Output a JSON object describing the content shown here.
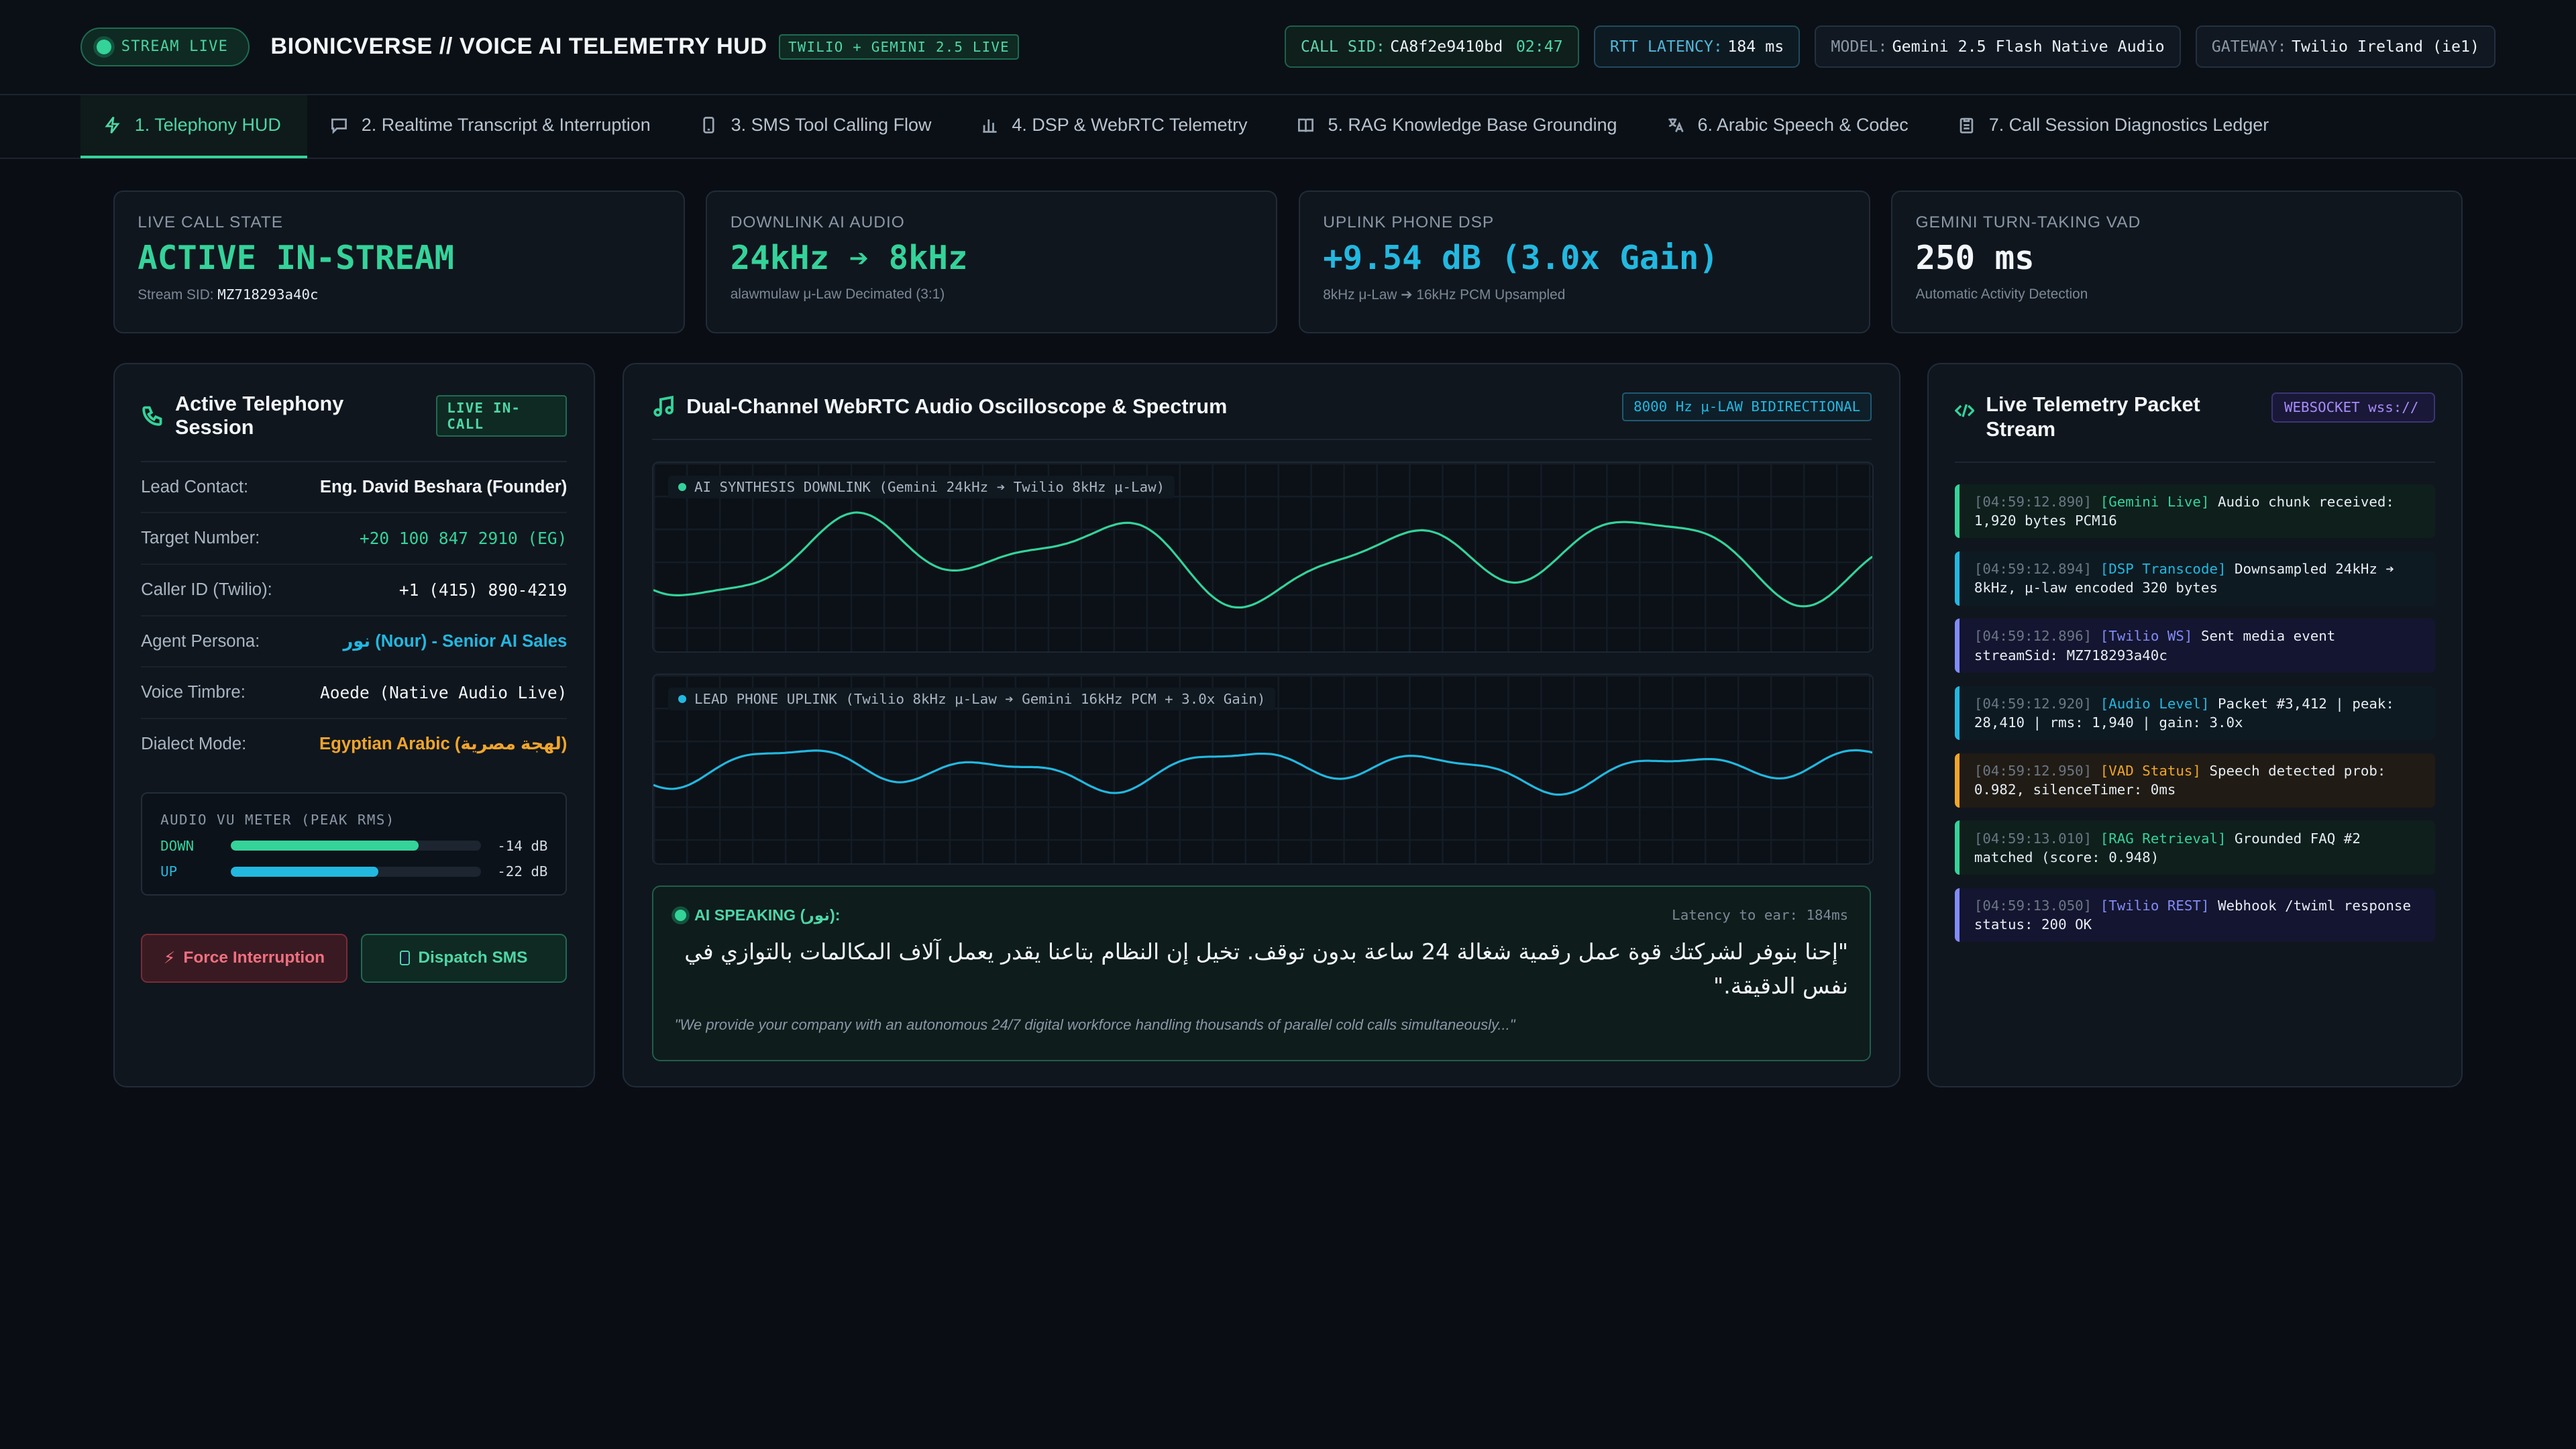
{
  "header": {
    "live_label": "STREAM LIVE",
    "title": "BIONICVERSE // VOICE AI TELEMETRY HUD",
    "tag": "TWILIO + GEMINI 2.5 LIVE",
    "call_sid_key": "CALL SID:",
    "call_sid": "CA8f2e9410bd",
    "call_time": "02:47",
    "rtt_key": "RTT LATENCY:",
    "rtt": "184 ms",
    "model_key": "MODEL:",
    "model": "Gemini 2.5 Flash Native Audio",
    "gateway_key": "GATEWAY:",
    "gateway": "Twilio Ireland (ie1)"
  },
  "tabs": [
    {
      "label": "1. Telephony HUD",
      "icon": "bolt-icon"
    },
    {
      "label": "2. Realtime Transcript & Interruption",
      "icon": "message-icon"
    },
    {
      "label": "3. SMS Tool Calling Flow",
      "icon": "phone-device-icon"
    },
    {
      "label": "4. DSP & WebRTC Telemetry",
      "icon": "bar-chart-icon"
    },
    {
      "label": "5. RAG Knowledge Base Grounding",
      "icon": "book-icon"
    },
    {
      "label": "6. Arabic Speech & Codec",
      "icon": "translate-icon"
    },
    {
      "label": "7. Call Session Diagnostics Ledger",
      "icon": "clipboard-icon"
    }
  ],
  "stats": [
    {
      "label": "LIVE CALL STATE",
      "value": "ACTIVE IN-STREAM",
      "sub_prefix": "Stream SID: ",
      "sub_value": "MZ718293a40c",
      "color": "#34d399"
    },
    {
      "label": "DOWNLINK AI AUDIO",
      "value": "24kHz ➔ 8kHz",
      "sub": "alawmulaw μ-Law Decimated (3:1)",
      "color": "#34d399"
    },
    {
      "label": "UPLINK PHONE DSP",
      "value": "+9.54 dB (3.0x Gain)",
      "sub": "8kHz μ-Law ➔ 16kHz PCM Upsampled",
      "color": "#22b8e0"
    },
    {
      "label": "GEMINI TURN-TAKING VAD",
      "value": "250 ms",
      "sub": "Automatic Activity Detection",
      "color": "#f2f6fa"
    }
  ],
  "session": {
    "title": "Active Telephony Session",
    "badge": "LIVE IN-CALL",
    "rows": [
      {
        "key": "Lead Contact:",
        "value": "Eng. David Beshara (Founder)"
      },
      {
        "key": "Target Number:",
        "value": "+20 100 847 2910 (EG)"
      },
      {
        "key": "Caller ID (Twilio):",
        "value": "+1 (415) 890-4219"
      },
      {
        "key": "Agent Persona:",
        "value": "نور (Nour) - Senior AI Sales"
      },
      {
        "key": "Voice Timbre:",
        "value": "Aoede (Native Audio Live)"
      },
      {
        "key": "Dialect Mode:",
        "value": "Egyptian Arabic (لهجة مصرية)"
      }
    ],
    "vu": {
      "title": "AUDIO VU METER (PEAK RMS)",
      "down_label": "DOWN",
      "down_db": "-14 dB",
      "down_level": 0.75,
      "up_label": "UP",
      "up_db": "-22 dB",
      "up_level": 0.59
    },
    "btn_interrupt": "Force Interruption",
    "btn_sms": "Dispatch SMS"
  },
  "scope": {
    "title": "Dual-Channel WebRTC Audio Oscilloscope & Spectrum",
    "badge": "8000 Hz μ-LAW BIDIRECTIONAL",
    "downlink_label": "AI SYNTHESIS DOWNLINK (Gemini 24kHz ➔ Twilio 8kHz μ-Law)",
    "uplink_label": "LEAD PHONE UPLINK (Twilio 8kHz μ-Law ➔ Gemini 16kHz PCM + 3.0x Gain)",
    "downlink_color": "#34d399",
    "uplink_color": "#22b8e0",
    "speaking_label": "AI SPEAKING (نور):",
    "latency": "Latency to ear: 184ms",
    "arabic_text": "\"إحنا بنوفر لشركتك قوة عمل رقمية شغالة 24 ساعة بدون توقف. تخيل إن النظام بتاعنا يقدر يعمل آلاف المكالمات بالتوازي في نفس الدقيقة.\"",
    "english_text": "\"We provide your company with an autonomous 24/7 digital workforce handling thousands of parallel cold calls simultaneously...\""
  },
  "stream": {
    "title": "Live Telemetry Packet Stream",
    "badge": "WEBSOCKET wss://",
    "packets": [
      {
        "ts": "[04:59:12.890]",
        "src": "[Gemini Live]",
        "msg": "Audio chunk received: 1,920 bytes PCM16",
        "color": "#34d399",
        "bg": "#0e1f1c"
      },
      {
        "ts": "[04:59:12.894]",
        "src": "[DSP Transcode]",
        "msg": "Downsampled 24kHz ➔ 8kHz, μ-law encoded 320 bytes",
        "color": "#22b8e0",
        "bg": "#0e1a22"
      },
      {
        "ts": "[04:59:12.896]",
        "src": "[Twilio WS]",
        "msg": "Sent media event streamSid: MZ718293a40c",
        "color": "#818cf8",
        "bg": "#141530"
      },
      {
        "ts": "[04:59:12.920]",
        "src": "[Audio Level]",
        "msg": "Packet #3,412 | peak: 28,410 | rms: 1,940 | gain: 3.0x",
        "color": "#22b8e0",
        "bg": "#0e1a22"
      },
      {
        "ts": "[04:59:12.950]",
        "src": "[VAD Status]",
        "msg": "Speech detected prob: 0.982, silenceTimer: 0ms",
        "color": "#f0a52a",
        "bg": "#201b14"
      },
      {
        "ts": "[04:59:13.010]",
        "src": "[RAG Retrieval]",
        "msg": "Grounded FAQ #2 matched (score: 0.948)",
        "color": "#34d399",
        "bg": "#0e1f1c"
      },
      {
        "ts": "[04:59:13.050]",
        "src": "[Twilio REST]",
        "msg": "Webhook /twiml response status: 200 OK",
        "color": "#818cf8",
        "bg": "#141530"
      }
    ]
  }
}
